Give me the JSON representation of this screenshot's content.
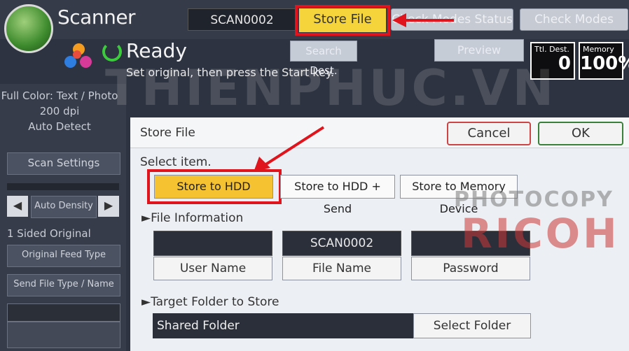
{
  "app": {
    "title": "Scanner"
  },
  "header": {
    "file_name": "SCAN0002",
    "store_file_label": "Store File",
    "check_status_label": "Check Modes Status",
    "check_modes_label": "Check Modes"
  },
  "status": {
    "state": "Ready",
    "message": "Set original, then press the Start key.",
    "search_dest_label": "Search Dest.",
    "preview_label": "Preview"
  },
  "counters": {
    "ttl_dest_label": "Ttl. Dest.",
    "ttl_dest_value": "0",
    "memory_label": "Memory",
    "memory_value": "100%"
  },
  "watermark": "THIENPHUC.VN",
  "sidebar": {
    "mode_line1": "Full Color: Text / Photo",
    "mode_line2": "200 dpi",
    "mode_line3": "Auto Detect",
    "scan_settings_label": "Scan Settings",
    "auto_density_label": "Auto Density",
    "sided_original_label": "1 Sided Original",
    "original_feed_type_label": "Original Feed Type",
    "send_file_type_label": "Send File Type / Name"
  },
  "dialog": {
    "title": "Store File",
    "cancel_label": "Cancel",
    "ok_label": "OK",
    "select_item_label": "Select item.",
    "options": {
      "store_to_hdd": "Store to HDD",
      "store_hdd_send": "Store to HDD + Send",
      "store_memory_device": "Store to Memory Device"
    },
    "file_info": {
      "heading": "►File Information",
      "user_name_value": "",
      "file_name_value": "SCAN0002",
      "password_value": "",
      "user_name_label": "User Name",
      "file_name_label": "File Name",
      "password_label": "Password"
    },
    "target_folder": {
      "heading": "►Target Folder to Store",
      "shared_folder_value": "Shared Folder",
      "select_folder_label": "Select Folder"
    }
  },
  "brand": {
    "line1": "PHOTOCOPY",
    "line2": "RICOH"
  },
  "colors": {
    "highlight_red": "#e0141c",
    "selected_yellow": "#f5c232",
    "ready_green": "#3ccb3c"
  }
}
